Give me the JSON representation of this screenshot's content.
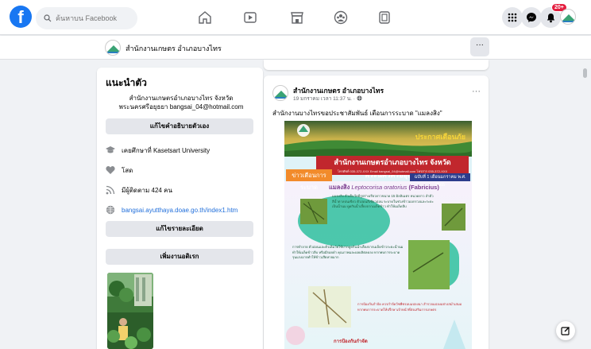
{
  "topbar": {
    "search_placeholder": "ค้นหาบน Facebook",
    "notifications_badge": "20+"
  },
  "page_header": {
    "name": "สำนักงานเกษตร อำเภอบางไทร",
    "more_label": "···"
  },
  "intro": {
    "title": "แนะนำตัว",
    "description": "สำนักงานเกษตรอำเภอบางไทร จังหวัดพระนครศรีอยุธยา bangsai_04@hotmail.com",
    "edit_bio_label": "แก้ไขคำอธิบายตัวเอง",
    "education": "เคยศึกษาที่ Kasetsart University",
    "relationship": "โสด",
    "followers": "มีผู้ติดตาม 424 คน",
    "website": "bangsai.ayutthaya.doae.go.th/index1.htm",
    "edit_details_label": "แก้ไขรายละเอียด",
    "add_hobbies_label": "เพิ่มงานอดิเรก"
  },
  "post": {
    "author": "สำนักงานเกษตร อำเภอบางไทร",
    "meta": "19 มกราคม เวลา 11:37 น. · ",
    "more_label": "···",
    "text": "สำนักงานบางไทรขอประชาสัมพันธ์  เตือนการระบาด  \"แมลงสิง\""
  },
  "poster": {
    "header": "ประกาศเตือนภัย",
    "org": "สำนักงานเกษตรอำเภอบางไทร จังหวัดพระนครศรีอยุธยา",
    "contact": "โทรศัพท์ 035-372-XXX  Email bangsai_04@hotmail.com  โทรสาร 035-372-XXX",
    "tag": "ข่าวเตือนการระบาด",
    "date": "ฉบับที่ 1 เดือนมกราคม พ.ศ. 2565",
    "pest_thai": "แมลงสิง",
    "pest_latin": "Leptocorisa oratorius",
    "pest_author": "(Fabricius)",
    "body_1": "แมลงสิง ตัวเต็มวัยมีรูปร่างเรียวยาวขนาด 15 มิลลิเมตร หนวดยาว ลำตัวสีน้ำตาลปนเขียว ตัวอ่อนสีเขียวอ่อน ระบาดในช่วงข้าวออกรวงและระยะเป็นน้ำนม ดูดกินน้ำเลี้ยงจากเมล็ดข้าว ทำให้เมล็ดลีบ",
    "body_2": "การทำลาย ตัวอ่อนและตัวเต็มวัยใช้ปากดูดกินน้ำเลี้ยงจากเมล็ดข้าวระยะน้ำนม ทำให้เมล็ดข้าวลีบ หรือมีรอยดำ คุณภาพและผลผลิตลดลง หากพบการระบาดรุนแรงอาจทำให้ข้าวเสียหายมาก",
    "body_3": "การป้องกันกำจัด ควรกำจัดวัชพืชรอบแปลงนา สำรวจแปลงอย่างสม่ำเสมอ หากพบการระบาดให้ปรึกษาเจ้าหน้าที่ส่งเสริมการเกษตร",
    "closing": "การป้องกันกำจัด"
  },
  "colors": {
    "fb_blue": "#1877f2",
    "link": "#216fdb",
    "badge": "#e41e3f"
  }
}
